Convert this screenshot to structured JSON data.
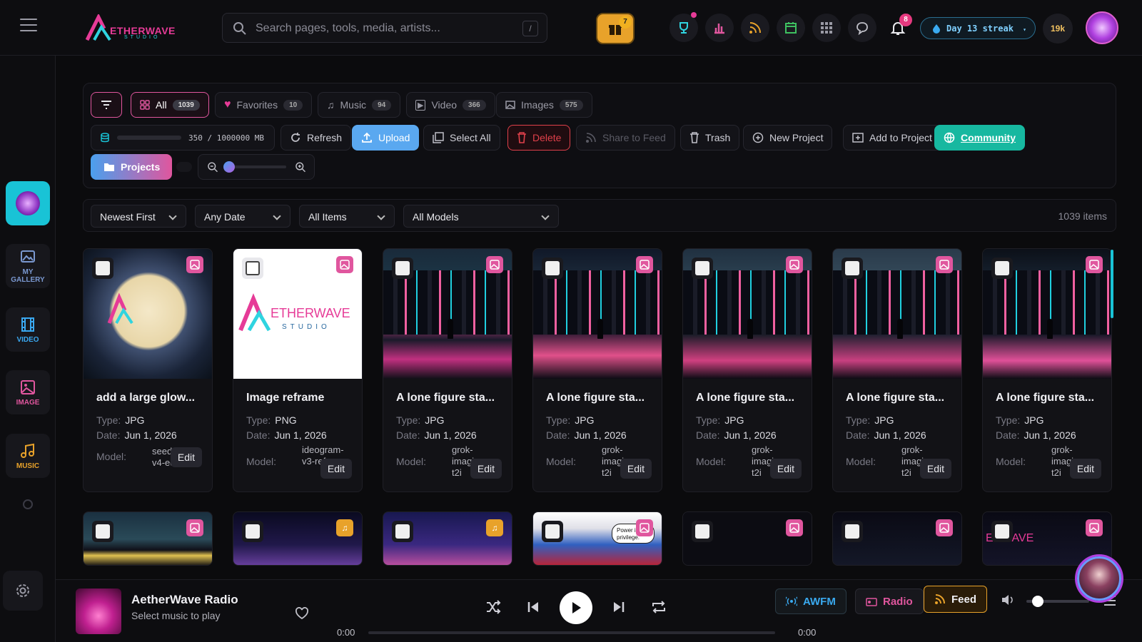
{
  "header": {
    "logo_line1": "ETHERWAVE",
    "logo_line2": "STUDIO",
    "search_placeholder": "Search pages, tools, media, artists...",
    "search_shortcut": "/",
    "gift_badge": "7",
    "notif_badge": "8",
    "streak": "Day 13 streak",
    "points": "19k"
  },
  "sidebar": {
    "items": [
      {
        "label": "MY\nGALLERY"
      },
      {
        "label": "VIDEO"
      },
      {
        "label": "IMAGE"
      },
      {
        "label": "MUSIC"
      }
    ]
  },
  "tabs": [
    {
      "label": "All",
      "count": "1039"
    },
    {
      "label": "Favorites",
      "count": "10"
    },
    {
      "label": "Music",
      "count": "94"
    },
    {
      "label": "Video",
      "count": "366"
    },
    {
      "label": "Images",
      "count": "575"
    }
  ],
  "storage": "350 / 1000000 MB",
  "toolbar": {
    "refresh": "Refresh",
    "upload": "Upload",
    "select_all": "Select All",
    "delete": "Delete",
    "share": "Share to Feed",
    "trash": "Trash",
    "new_project": "New Project",
    "add_to_project": "Add to Project",
    "community": "Community",
    "projects": "Projects"
  },
  "filters": {
    "sort": "Newest First",
    "date": "Any Date",
    "items": "All Items",
    "models": "All Models",
    "count": "1039 items"
  },
  "labels": {
    "type": "Type:",
    "date": "Date:",
    "model": "Model:",
    "edit": "Edit"
  },
  "cards": [
    {
      "title": "add a large glow...",
      "type": "JPG",
      "date": "Jun 1, 2026",
      "model": "seedream-v4-edit"
    },
    {
      "title": "Image reframe",
      "type": "PNG",
      "date": "Jun 1, 2026",
      "model": "ideogram-v3-reframe"
    },
    {
      "title": "A lone figure sta...",
      "type": "JPG",
      "date": "Jun 1, 2026",
      "model": "grok-imagine-t2i"
    },
    {
      "title": "A lone figure sta...",
      "type": "JPG",
      "date": "Jun 1, 2026",
      "model": "grok-imagine-t2i"
    },
    {
      "title": "A lone figure sta...",
      "type": "JPG",
      "date": "Jun 1, 2026",
      "model": "grok-imagine-t2i"
    },
    {
      "title": "A lone figure sta...",
      "type": "JPG",
      "date": "Jun 1, 2026",
      "model": "grok-imagine-t2i"
    },
    {
      "title": "A lone figure sta...",
      "type": "JPG",
      "date": "Jun 1, 2026",
      "model": "grok-imagine-t2i"
    }
  ],
  "row2_thumb_text": {
    "comic": "Power is privilege.",
    "logo": "ERWAVE"
  },
  "player": {
    "title": "AetherWave Radio",
    "subtitle": "Select music to play",
    "time_start": "0:00",
    "time_end": "0:00",
    "awfm": "AWFM",
    "radio": "Radio",
    "feed": "Feed"
  },
  "colors": {
    "accent_pink": "#e0569e",
    "accent_cyan": "#19c3d6",
    "upload_blue": "#5aa8f0",
    "community_green": "#17b8a0",
    "music_orange": "#e8a22a",
    "delete_red": "#e0404a"
  }
}
